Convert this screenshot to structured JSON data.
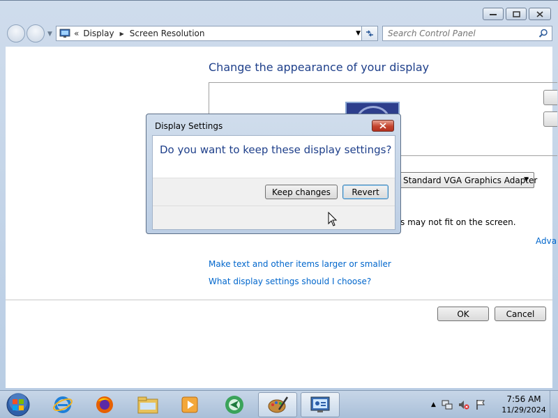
{
  "window": {
    "breadcrumb": [
      "Display",
      "Screen Resolution"
    ],
    "search_placeholder": "Search Control Panel"
  },
  "content": {
    "title": "Change the appearance of your display",
    "adapter_value": "Standard VGA Graphics Adapter",
    "fit_text_partial": "s may not fit on the screen.",
    "advanced_link_partial": "Adva",
    "links": [
      "Make text and other items larger or smaller",
      "What display settings should I choose?"
    ],
    "ok_label": "OK",
    "cancel_label": "Cancel"
  },
  "dialog": {
    "title": "Display Settings",
    "message": "Do you want to keep these display settings?",
    "keep_label": "Keep changes",
    "revert_label": "Revert"
  },
  "taskbar": {
    "items": [
      "start-orb-icon",
      "internet-explorer-icon",
      "firefox-icon",
      "file-explorer-icon",
      "media-player-icon",
      "app-arrow-icon",
      "paint-icon",
      "control-panel-icon"
    ],
    "active_item": "control-panel-icon",
    "time": "7:56 AM",
    "date": "11/29/2024"
  },
  "colors": {
    "title_blue": "#1e3f8a",
    "link_blue": "#0066cc",
    "close_red": "#c4452f"
  }
}
